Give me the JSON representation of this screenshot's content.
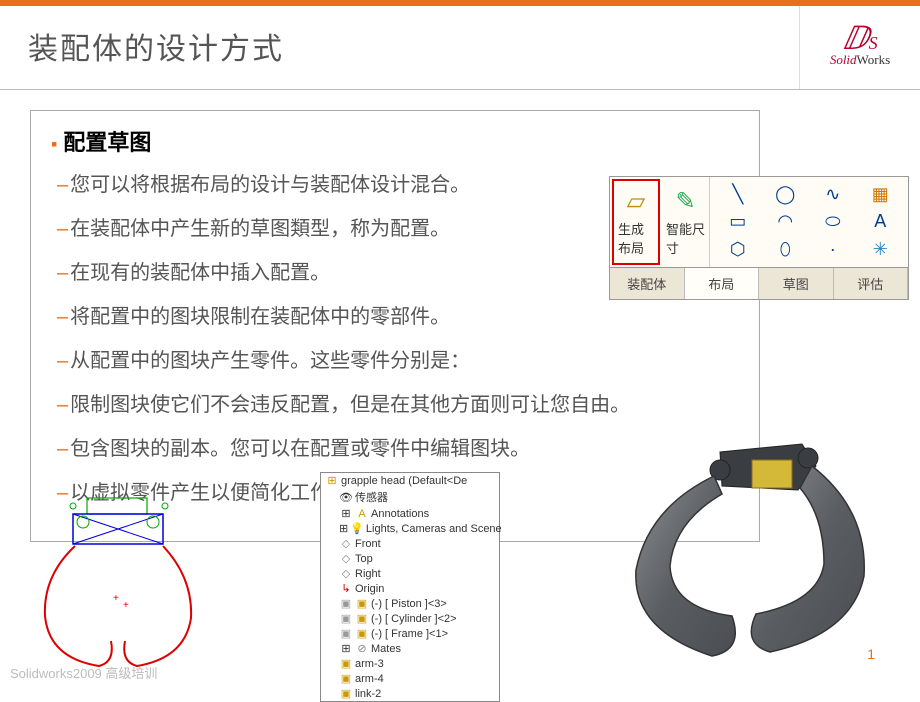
{
  "header": {
    "title": "装配体的设计方式",
    "logo_solid": "Solid",
    "logo_works": "Works"
  },
  "section": {
    "heading": "配置草图",
    "bullets": [
      "您可以将根据布局的设计与装配体设计混合。",
      "在装配体中产生新的草图類型，称为配置。",
      "在现有的装配体中插入配置。",
      "将配置中的图块限制在装配体中的零部件。",
      "从配置中的图块产生零件。这些零件分别是：",
      "限制图块使它们不会违反配置，但是在其他方面则可让您自由。",
      "包含图块的副本。您可以在配置或零件中编辑图块。",
      "以虚拟零件产生以便简化工作流程图块插入点"
    ]
  },
  "toolbar": {
    "btn1": "生成布局",
    "btn2": "智能尺寸",
    "tabs": [
      "装配体",
      "布局",
      "草图",
      "评估"
    ]
  },
  "tree": {
    "root": "grapple head (Default<De",
    "items": [
      "传感器",
      "Annotations",
      "Lights, Cameras and Scene",
      "Front",
      "Top",
      "Right",
      "Origin",
      "(-) [ Piston ]<3>",
      "(-) [ Cylinder ]<2>",
      "(-) [ Frame ]<1>",
      "Mates",
      "arm-3",
      "arm-4",
      "link-2"
    ]
  },
  "footer": {
    "text": "Solidworks2009 高级培训",
    "page": "1"
  }
}
